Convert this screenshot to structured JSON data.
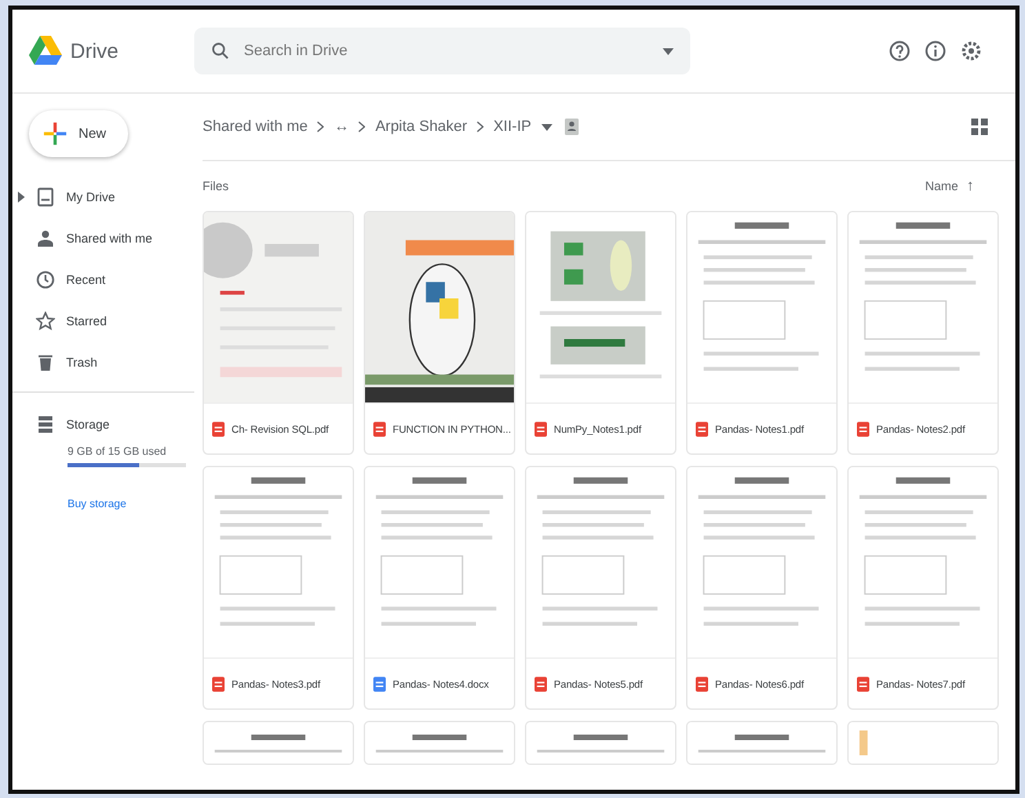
{
  "app": {
    "title": "Drive"
  },
  "search": {
    "placeholder": "Search in Drive"
  },
  "new_button": {
    "label": "New"
  },
  "sidebar": {
    "items": [
      {
        "label": "My Drive",
        "expandable": true
      },
      {
        "label": "Shared with me",
        "expandable": false
      },
      {
        "label": "Recent",
        "expandable": false
      },
      {
        "label": "Starred",
        "expandable": false
      },
      {
        "label": "Trash",
        "expandable": false
      }
    ],
    "storage": {
      "label": "Storage",
      "usage": "9 GB of 15 GB used",
      "level": 0.6,
      "link": "Buy storage"
    }
  },
  "breadcrumb": [
    "Shared with me",
    "↔",
    "Arpita Shaker",
    "XII-IP"
  ],
  "section": {
    "title": "Files",
    "sort": "Name",
    "sort_arrow": "↑"
  },
  "files": [
    {
      "name": "Ch- Revision SQL.pdf",
      "kind": "pdf"
    },
    {
      "name": "FUNCTION IN PYTHON...",
      "kind": "pdf"
    },
    {
      "name": "NumPy_Notes1.pdf",
      "kind": "pdf"
    },
    {
      "name": "Pandas- Notes1.pdf",
      "kind": "pdf"
    },
    {
      "name": "Pandas- Notes2.pdf",
      "kind": "pdf"
    },
    {
      "name": "Pandas- Notes3.pdf",
      "kind": "pdf"
    },
    {
      "name": "Pandas- Notes4.docx",
      "kind": "docx"
    },
    {
      "name": "Pandas- Notes5.pdf",
      "kind": "pdf"
    },
    {
      "name": "Pandas- Notes6.pdf",
      "kind": "pdf"
    },
    {
      "name": "Pandas- Notes7.pdf",
      "kind": "pdf"
    }
  ]
}
